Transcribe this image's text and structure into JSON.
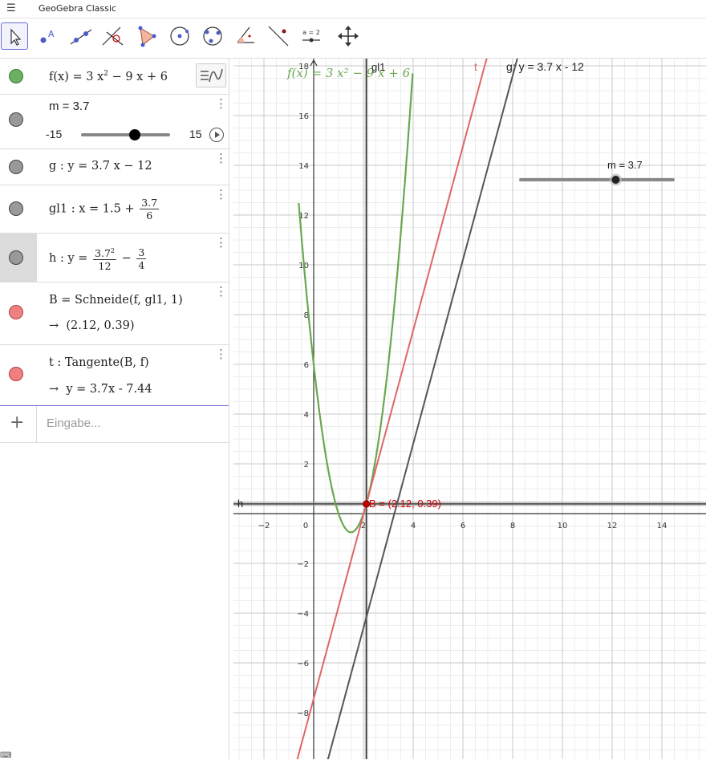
{
  "window": {
    "title": "GeoGebra Classic",
    "menu_icon": "hamburger-menu-icon"
  },
  "toolbar": {
    "tools": [
      {
        "name": "move-tool",
        "selected": true
      },
      {
        "name": "point-tool"
      },
      {
        "name": "line-tool"
      },
      {
        "name": "perpendicular-line-tool"
      },
      {
        "name": "polygon-tool"
      },
      {
        "name": "circle-center-point-tool"
      },
      {
        "name": "circle-three-points-tool"
      },
      {
        "name": "angle-tool"
      },
      {
        "name": "reflect-tool"
      },
      {
        "name": "slider-tool",
        "label": "a = 2"
      },
      {
        "name": "move-graphics-view-tool"
      }
    ]
  },
  "algebra": {
    "rows": [
      {
        "id": "f",
        "color": "#6aaf62",
        "name": "f(x)",
        "eq": "=",
        "term1": "3 x",
        "exp": "2",
        "term2": "− 9 x + 6",
        "filled": true
      },
      {
        "id": "m",
        "color": "#555555",
        "label": "m = 3.7",
        "slider_min": "-15",
        "slider_max": "15",
        "value": 3.7
      },
      {
        "id": "g",
        "color": "#555555",
        "text": "g :  y = 3.7 x − 12"
      },
      {
        "id": "gl1",
        "color": "#555555",
        "prefix": "gl1 :  x = 1.5 +",
        "frac_num": "3.7",
        "frac_den": "6"
      },
      {
        "id": "h",
        "color": "#555555",
        "prefix": "h :  y =",
        "frac1_num": "3.7",
        "frac1_exp": "2",
        "frac1_den": "12",
        "minus": "−",
        "frac2_num": "3",
        "frac2_den": "4"
      },
      {
        "id": "B",
        "color": "#e06666",
        "text": "B = Schneide(f, gl1, 1)",
        "result_arrow": "→",
        "result": "(2.12, 0.39)"
      },
      {
        "id": "t",
        "color": "#e06666",
        "text": "t : Tangente(B, f)",
        "result_arrow": "→",
        "result": "y = 3.7x - 7.44"
      }
    ],
    "input_placeholder": "Eingabe...",
    "add_icon": "+"
  },
  "graphics": {
    "x_ticks": [
      "−2",
      "0",
      "2",
      "4",
      "6",
      "8",
      "10",
      "12",
      "14"
    ],
    "y_ticks": [
      "18",
      "16",
      "14",
      "12",
      "10",
      "8",
      "6",
      "4",
      "2",
      "−2",
      "−4",
      "−6",
      "−8"
    ],
    "labels": {
      "f": "f(x) = 3 x² − 9 x + 6",
      "gl1": "gl1",
      "t": "t",
      "g": "g: y = 3.7 x - 12",
      "h": "h",
      "B": "B = (2.12, 0.39)",
      "slider": "m = 3.7"
    },
    "colors": {
      "f": "#6aa84f",
      "t": "#e06666",
      "g": "#555555",
      "B": "#cc0000",
      "axis": "#333333"
    }
  }
}
